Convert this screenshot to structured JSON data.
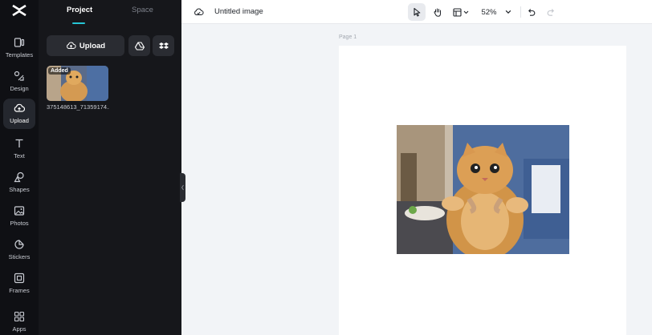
{
  "rail": {
    "items": [
      {
        "label": "Templates",
        "icon": "templates-icon"
      },
      {
        "label": "Design",
        "icon": "design-icon"
      },
      {
        "label": "Upload",
        "icon": "upload-cloud-icon",
        "active": true
      },
      {
        "label": "Text",
        "icon": "text-icon"
      },
      {
        "label": "Shapes",
        "icon": "shapes-icon"
      },
      {
        "label": "Photos",
        "icon": "photos-icon"
      },
      {
        "label": "Stickers",
        "icon": "stickers-icon"
      },
      {
        "label": "Frames",
        "icon": "frames-icon"
      },
      {
        "label": "Apps",
        "icon": "apps-icon"
      }
    ]
  },
  "panel": {
    "tabs": [
      {
        "label": "Project",
        "active": true
      },
      {
        "label": "Space",
        "active": false
      }
    ],
    "upload_label": "Upload",
    "media": [
      {
        "badge": "Added",
        "name": "375148613_71359174..."
      }
    ]
  },
  "topbar": {
    "title": "Untitled image",
    "zoom": "52%"
  },
  "canvas": {
    "page_label": "Page 1"
  },
  "colors": {
    "accent": "#25c6d6",
    "rail_bg": "#0f1014",
    "panel_bg": "#16171b",
    "canvas_bg": "#f2f4f7"
  }
}
